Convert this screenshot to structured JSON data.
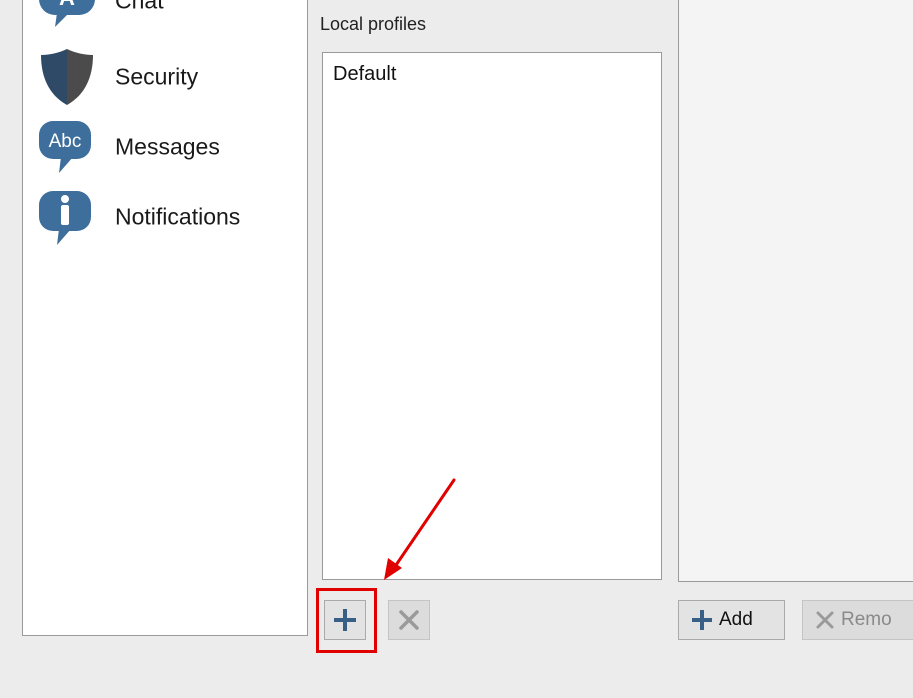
{
  "nav": {
    "items": [
      {
        "label": "Chat",
        "icon": "chat-icon"
      },
      {
        "label": "Security",
        "icon": "shield-icon"
      },
      {
        "label": "Messages",
        "icon": "abc-bubble-icon",
        "icon_text": "Abc"
      },
      {
        "label": "Notifications",
        "icon": "info-bubble-icon"
      }
    ]
  },
  "profiles": {
    "title": "Local profiles",
    "items": [
      "Default"
    ]
  },
  "buttons": {
    "add": "Add",
    "remove": "Remo"
  },
  "colors": {
    "icon_blue": "#3d6e9c",
    "highlight": "#e10000",
    "panel_bg": "#ececec"
  }
}
